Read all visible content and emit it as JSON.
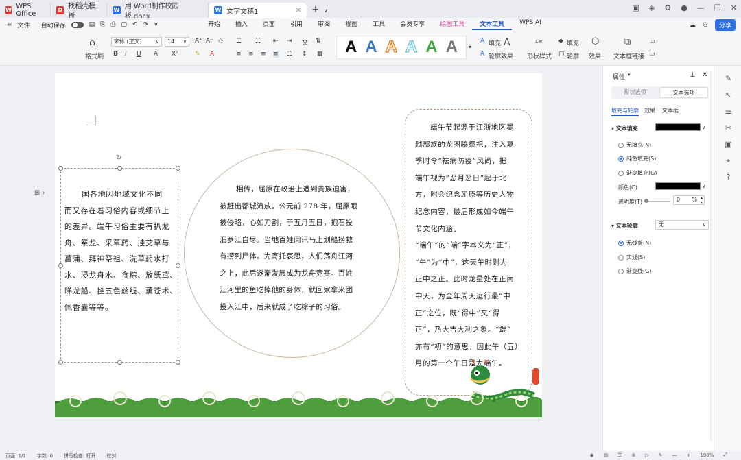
{
  "titlebar": {
    "tabs": [
      {
        "label": "WPS Office",
        "icon": "wps-logo-icon",
        "color": "#e0342f"
      },
      {
        "label": "找稻壳模板",
        "icon": "docer-icon",
        "color": "#e0342f"
      },
      {
        "label": "用 Word制作校园板.docx",
        "icon": "word-doc-icon",
        "color": "#2f6fe4"
      },
      {
        "label": "文字文稿1",
        "icon": "word-doc-icon",
        "color": "#2f6fe4"
      }
    ]
  },
  "menubar": {
    "file": "文件",
    "autosave": "自动保存",
    "tabs": [
      "开始",
      "插入",
      "页面",
      "引用",
      "审阅",
      "视图",
      "工具",
      "会员专享",
      "绘图工具",
      "文本工具",
      "WPS AI"
    ],
    "active_tab": "文本工具",
    "share": "分享"
  },
  "ribbon": {
    "format_painter": "格式刷",
    "font_name": "宋体 (正文)",
    "font_size": "14",
    "wordart_letter": "A",
    "fill": "填充",
    "outline": "轮廓",
    "effect": "效果",
    "shape_style": "形状样式",
    "shape_fill": "填充",
    "shape_outline": "轮廓",
    "shape_effect": "效果",
    "textbox_link": "文本框链接",
    "wordart_colors": [
      "#111111",
      "#3a76c4",
      "#e88a2e",
      "#7fc8d8",
      "#3faa3f",
      "#7a7a7a"
    ]
  },
  "document": {
    "left_text": "中国各地因地域文化不同而又存在着习俗内容或细节上的差异。端午习俗主要有扒龙舟、祭龙、采草药、挂艾草与菖蒲、拜神祭祖、洗草药水打午水、浸龙舟水、食粽、放纸鸢、睇龙船、拴五色丝线、薰苍术、佩香囊等等。",
    "left_lines": [
      "国各地因地域文化不同",
      "而又存在着习俗内容或细节上",
      "的差异。端午习俗主要有扒龙",
      "舟、祭龙、采草药、挂艾草与",
      "菖蒲、拜神祭祖、洗草药水打",
      "水、浸龙舟水、食粽、放纸鸢、",
      "睇龙船、拴五色丝线、薰苍术、",
      "佩香囊等等。"
    ],
    "circle_lines": [
      "相传，屈原在政治上遭到贵族迫害，",
      "被赶出都城流放。公元前 278 年，屈原眼",
      "被侵略，心如刀割，于五月五日，抱石投",
      "汨罗江自尽。当地百姓闻讯马上划船捞救",
      "有捞到尸体。为寄托哀思，人们荡舟江河",
      "之上，此后逐渐发展成为龙舟竞赛。百姓",
      "江河里的鱼吃掉他的身体，就回家拿米团",
      "投入江中，后来就成了吃粽子的习俗。"
    ],
    "right_lines": [
      "端午节起源于江浙地区吴",
      "越部族的龙图腾祭祀，注入夏",
      "季时令“祛病防疫”风尚，把",
      "端午视为“恶月恶日”起于北",
      "方，附会纪念屈原等历史人物",
      "纪念内容，最后形成如今端午",
      "节文化内涵。",
      "“端午”的“端”字本义为“正”，",
      "“午”为“中”，这天午时则为",
      "正中之正。此时龙星处在正南",
      "中天，为全年周天运行最“中",
      "正”之位，既“得中”又“得",
      "正”，乃大吉大利之象。“端”",
      "亦有“初”的意思，因此午（五）",
      "月的第一个午日是为端午。"
    ]
  },
  "panel": {
    "title": "属性",
    "tabs": [
      "形状选项",
      "文本选项"
    ],
    "active_tab": "文本选项",
    "subtabs": [
      "填充与轮廓",
      "效果",
      "文本框"
    ],
    "text_fill": "文本填充",
    "fill_options": [
      "无填充(N)",
      "纯色填充(S)",
      "渐变填充(G)"
    ],
    "fill_selected": 1,
    "color_label": "颜色(C)",
    "transparency_label": "透明度(T)",
    "transparency_value": "0",
    "transparency_unit": "%",
    "text_outline": "文本轮廓",
    "outline_value": "无",
    "outline_options": [
      "无线条(N)",
      "实线(S)",
      "渐变线(G)"
    ],
    "outline_selected": 0,
    "fill_color": "#000000"
  },
  "status": {
    "page": "页面: 1/1",
    "words": "字数: 0",
    "spell": "拼写检查: 打开",
    "proof": "校对",
    "zoom": "100%"
  }
}
